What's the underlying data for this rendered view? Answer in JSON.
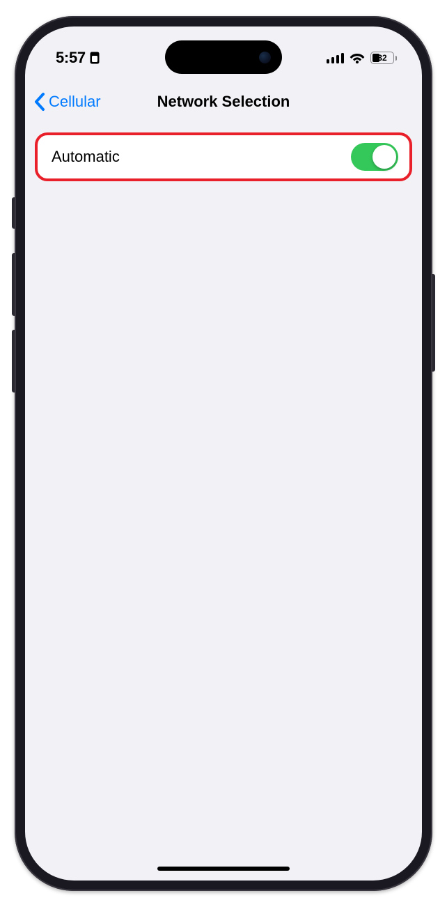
{
  "status": {
    "time": "5:57",
    "battery_percent": "32",
    "battery_level": 32
  },
  "nav": {
    "back_label": "Cellular",
    "title": "Network Selection"
  },
  "settings": {
    "automatic": {
      "label": "Automatic",
      "enabled": true
    }
  },
  "colors": {
    "tint": "#007aff",
    "toggle_on": "#34c759",
    "highlight_border": "#e9202a",
    "background": "#f2f1f6"
  }
}
